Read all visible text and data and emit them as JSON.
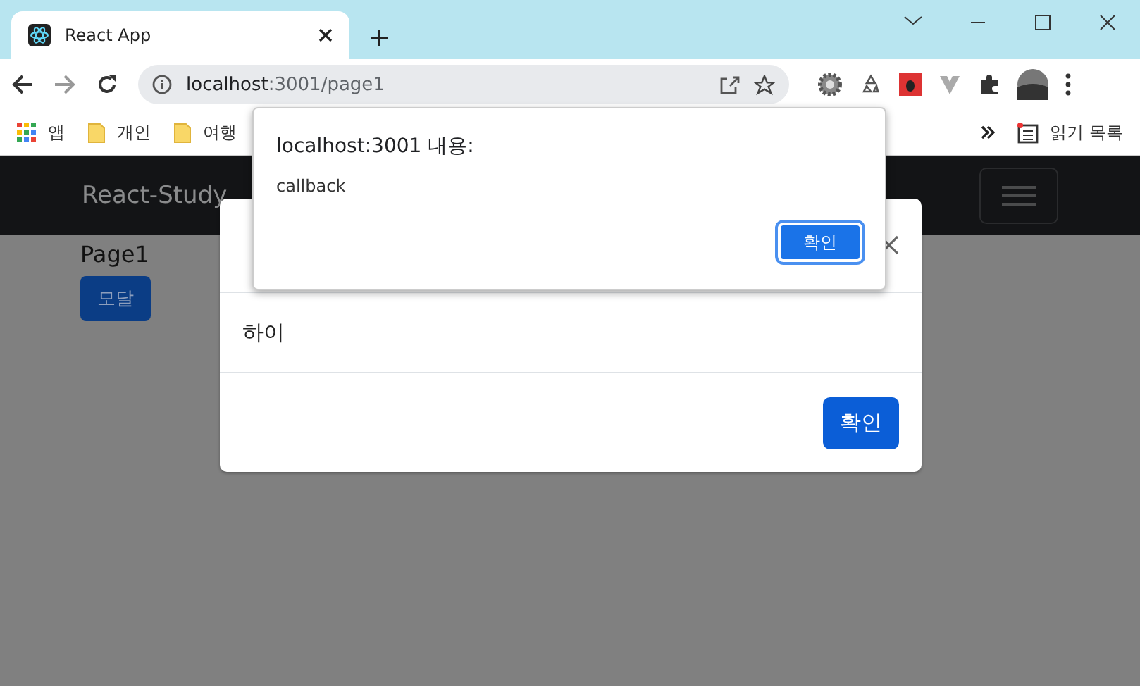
{
  "browser": {
    "tab_title": "React App",
    "url_host": "localhost",
    "url_rest": ":3001/page1",
    "bookmarks": [
      {
        "label": "앱",
        "kind": "apps"
      },
      {
        "label": "개인",
        "kind": "folder"
      },
      {
        "label": "여행",
        "kind": "folder"
      }
    ],
    "reading_list": "읽기 목록"
  },
  "navbar": {
    "brand": "React-Study"
  },
  "page": {
    "heading": "Page1",
    "button": "모달"
  },
  "modal": {
    "body": "하이",
    "confirm": "확인"
  },
  "alert": {
    "title": "localhost:3001 내용:",
    "message": "callback",
    "confirm": "확인"
  }
}
